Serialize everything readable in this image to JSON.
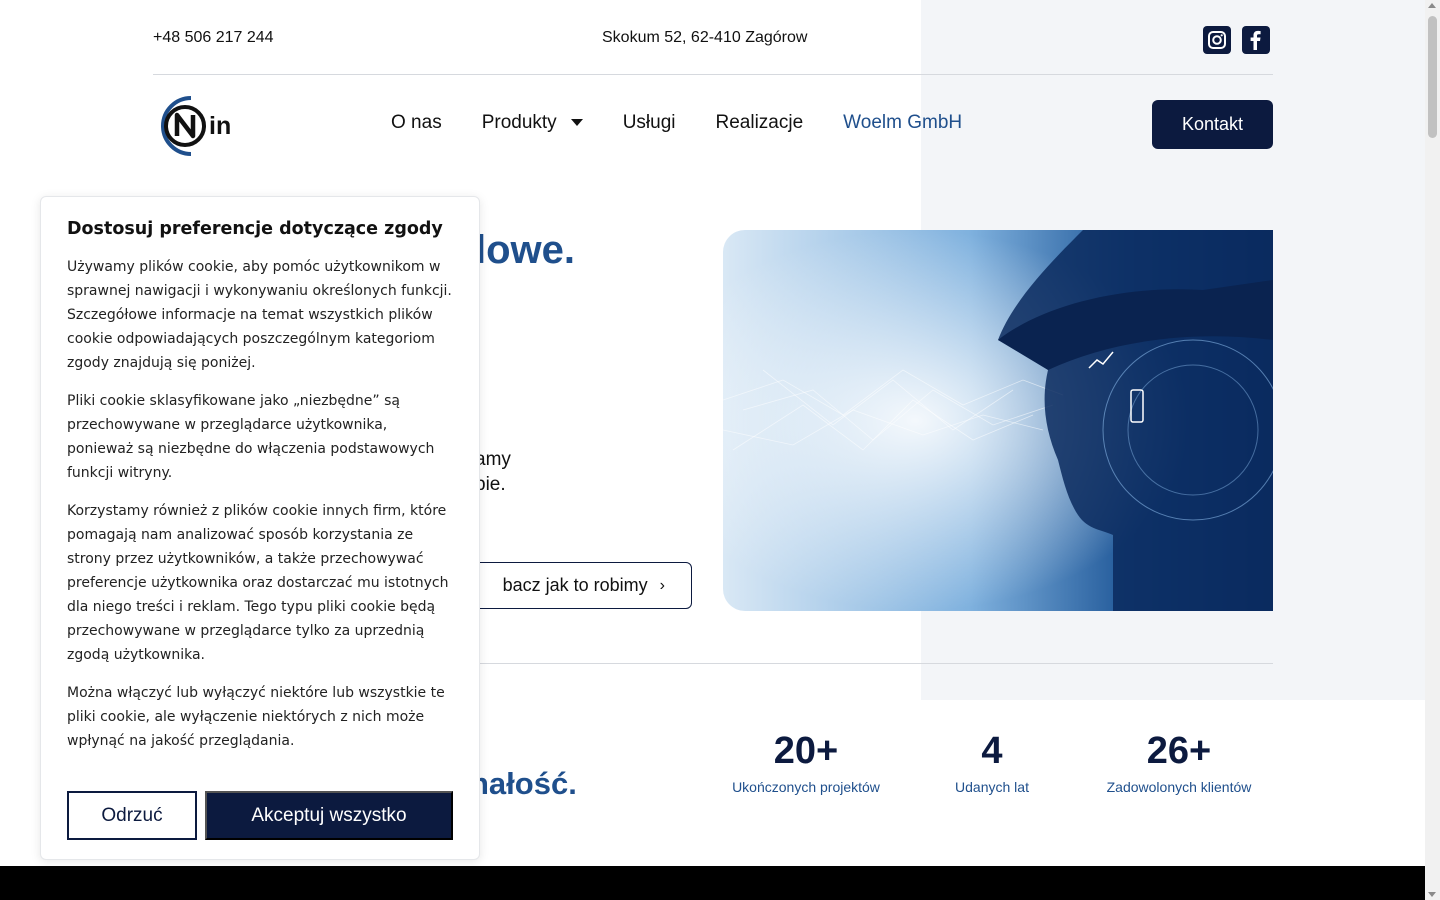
{
  "topbar": {
    "phone": "+48 506 217 244",
    "address": "Skokum 52, 62-410 Zagórow",
    "social": [
      {
        "icon": "instagram-icon"
      },
      {
        "icon": "facebook-icon"
      }
    ]
  },
  "nav": {
    "logo_text": "in",
    "items": [
      {
        "label": "O nas"
      },
      {
        "label": "Produkty"
      },
      {
        "label": "Usługi"
      },
      {
        "label": "Realizacje"
      },
      {
        "label": "Woelm GmbH"
      }
    ],
    "contact_label": "Kontakt"
  },
  "hero": {
    "title_visible": "lowe.",
    "text_line1": "amy",
    "text_line2": "pie.",
    "cta_label": "bacz jak to robimy"
  },
  "stats": {
    "left_title": "nałość.",
    "items": [
      {
        "number": "20+",
        "label": "Ukończonych projektów"
      },
      {
        "number": "4",
        "label": "Udanych lat"
      },
      {
        "number": "26+",
        "label": "Zadowolonych klientów"
      }
    ]
  },
  "cookie": {
    "title": "Dostosuj preferencje dotyczące zgody",
    "p1": "Używamy plików cookie, aby pomóc użytkownikom w sprawnej nawigacji i wykonywaniu określonych funkcji. Szczegółowe informacje na temat wszystkich plików cookie odpowiadających poszczególnym kategoriom zgody znajdują się poniżej.",
    "p2": "Pliki cookie sklasyfikowane jako „niezbędne” są przechowywane w przeglądarce użytkownika, ponieważ są niezbędne do włączenia podstawowych funkcji witryny.",
    "p3": "Korzystamy również z plików cookie innych firm, które pomagają nam analizować sposób korzystania ze strony przez użytkowników, a także przechowywać preferencje użytkownika oraz dostarczać mu istotnych dla niego treści i reklam. Tego typu pliki cookie będą przechowywane w przeglądarce tylko za uprzednią zgodą użytkownika.",
    "p4": "Można włączyć lub wyłączyć niektóre lub wszystkie te pliki cookie, ale wyłączenie niektórych z nich może wpłynąć na jakość przeglądania.",
    "reject_label": "Odrzuć",
    "accept_label": "Akceptuj wszystko"
  },
  "colors": {
    "navy": "#0c1a3f",
    "accent_blue": "#1f4f8c",
    "panel_grey": "#f3f5f8"
  }
}
